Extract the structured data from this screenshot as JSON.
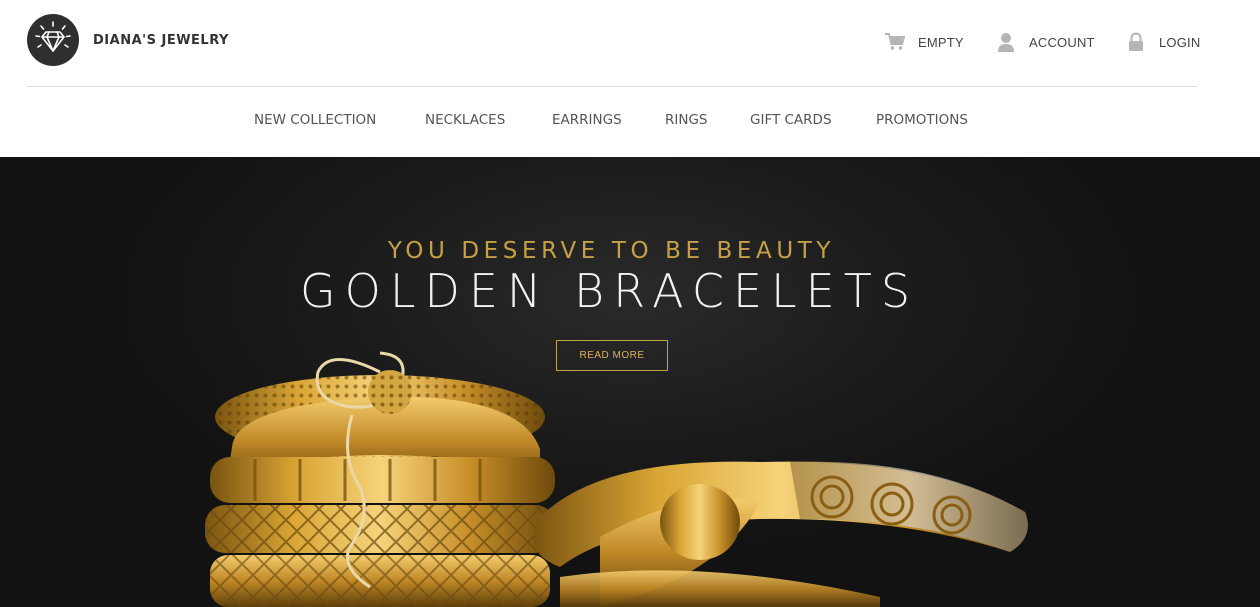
{
  "header": {
    "brand": "DIANA'S JEWELRY",
    "logo_icon": "diamond-icon",
    "cart": {
      "label": "EMPTY",
      "icon": "cart-icon"
    },
    "account": {
      "label": "ACCOUNT",
      "icon": "user-icon"
    },
    "login": {
      "label": "LOGIN",
      "icon": "lock-icon"
    }
  },
  "nav": {
    "items": [
      {
        "label": "NEW COLLECTION"
      },
      {
        "label": "NECKLACES"
      },
      {
        "label": "EARRINGS"
      },
      {
        "label": "RINGS"
      },
      {
        "label": "GIFT CARDS"
      },
      {
        "label": "PROMOTIONS"
      }
    ]
  },
  "hero": {
    "subtitle": "YOU DESERVE TO BE BEAUTY",
    "title": "GOLDEN BRACELETS",
    "button_label": "READ MORE",
    "image": "golden-bracelets-image"
  },
  "colors": {
    "accent_gold": "#c5a045",
    "hero_bg": "#1b1b1b",
    "nav_text": "#555555",
    "logo_bg": "#2f2f2f"
  }
}
